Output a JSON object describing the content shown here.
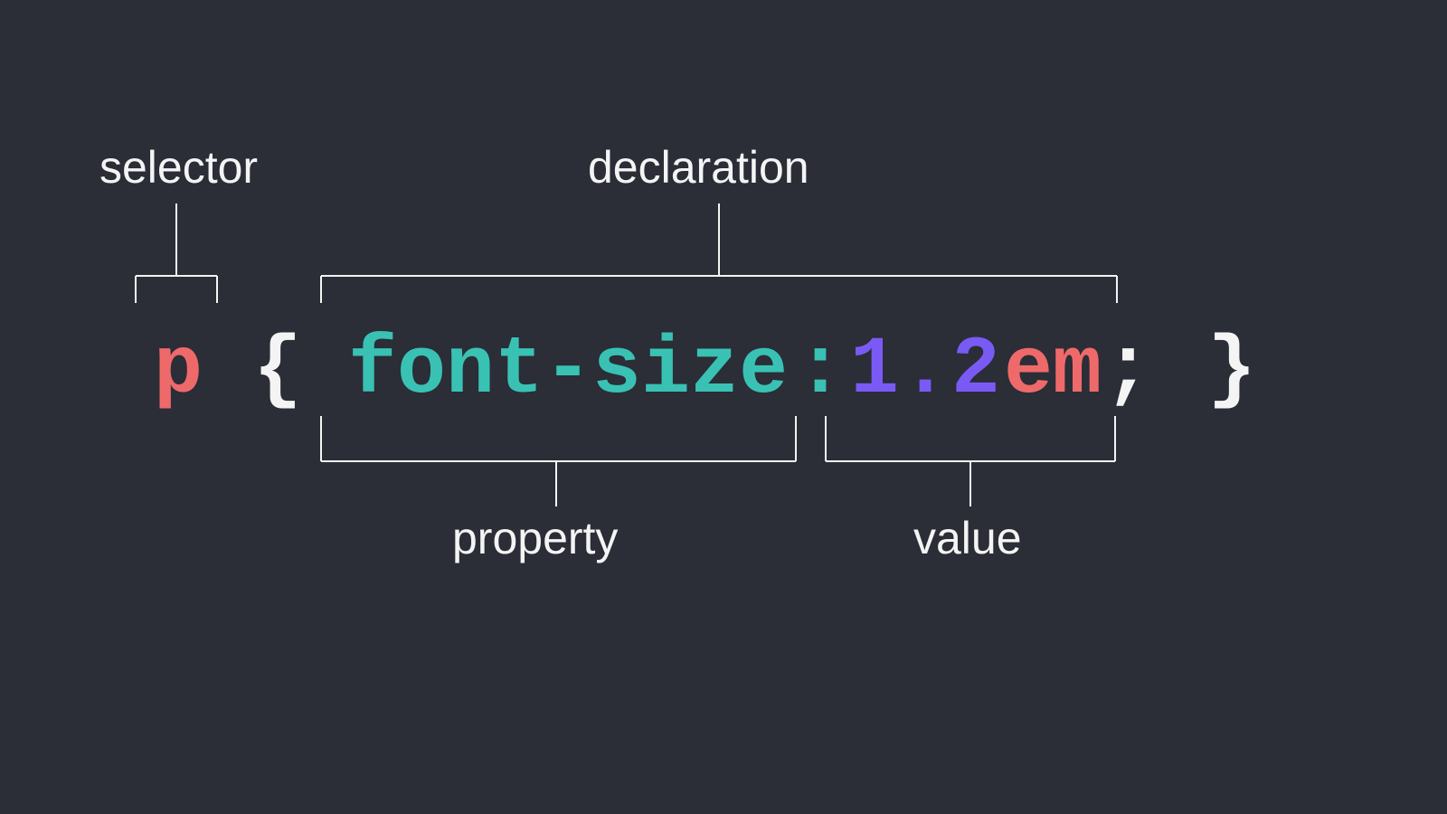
{
  "labels": {
    "selector": "selector",
    "declaration": "declaration",
    "property": "property",
    "value": "value"
  },
  "code": {
    "selector": "p",
    "brace_open": "{",
    "property": "font-size",
    "colon": ":",
    "space": " ",
    "number": "1.2",
    "unit": "em",
    "semicolon": ";",
    "brace_close": "}"
  }
}
